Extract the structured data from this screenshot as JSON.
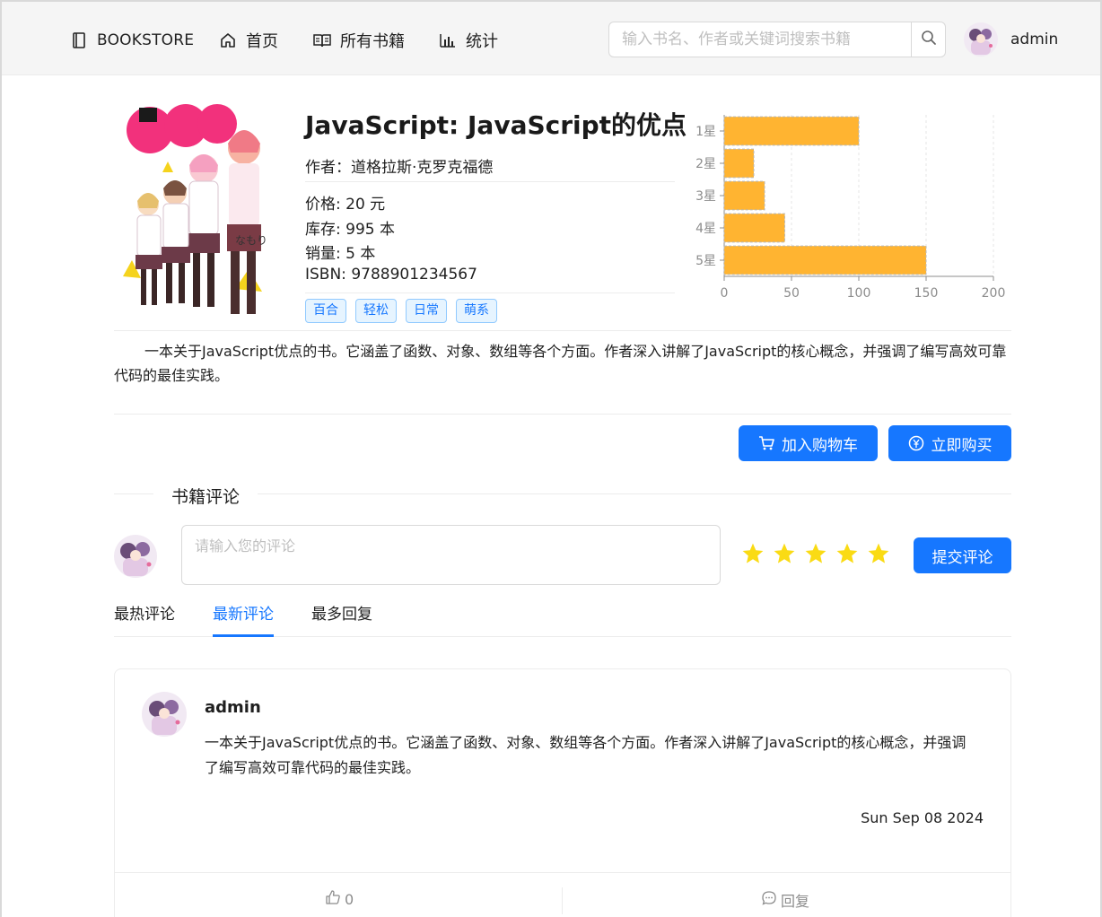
{
  "nav": {
    "brand": "BOOKSTORE",
    "home": "首页",
    "all_books": "所有书籍",
    "stats": "统计"
  },
  "search": {
    "placeholder": "输入书名、作者或关键词搜索书籍"
  },
  "user": {
    "name": "admin"
  },
  "book": {
    "title": "JavaScript: JavaScript的优点",
    "author": "作者：道格拉斯·克罗克福德",
    "price": "价格: 20 元",
    "stock": "库存: 995 本",
    "sales": "销量: 5 本",
    "isbn": "ISBN: 9788901234567",
    "tags": [
      "百合",
      "轻松",
      "日常",
      "萌系"
    ],
    "description": "一本关于JavaScript优点的书。它涵盖了函数、对象、数组等各个方面。作者深入讲解了JavaScript的核心概念，并强调了编写高效可靠代码的最佳实践。"
  },
  "chart_data": {
    "type": "bar",
    "orientation": "horizontal",
    "categories": [
      "1星",
      "2星",
      "3星",
      "4星",
      "5星"
    ],
    "values": [
      100,
      22,
      30,
      45,
      150
    ],
    "xlim": [
      0,
      200
    ],
    "xticks": [
      0,
      50,
      100,
      150,
      200
    ],
    "grid": true,
    "bar_color": "#ffb431"
  },
  "actions": {
    "add_to_cart": "加入购物车",
    "buy_now": "立即购买"
  },
  "comments": {
    "section_title": "书籍评论",
    "input_placeholder": "请输入您的评论",
    "stars": 5,
    "submit": "提交评论",
    "tabs": [
      "最热评论",
      "最新评论",
      "最多回复"
    ],
    "active_tab": "最新评论",
    "items": [
      {
        "user": "admin",
        "text": "一本关于JavaScript优点的书。它涵盖了函数、对象、数组等各个方面。作者深入讲解了JavaScript的核心概念，并强调了编写高效可靠代码的最佳实践。",
        "date": "Sun Sep 08 2024",
        "likes": "0",
        "reply_label": "回复"
      }
    ]
  },
  "colors": {
    "primary": "#1677ff",
    "star": "#fadb14",
    "bar": "#ffb431"
  }
}
